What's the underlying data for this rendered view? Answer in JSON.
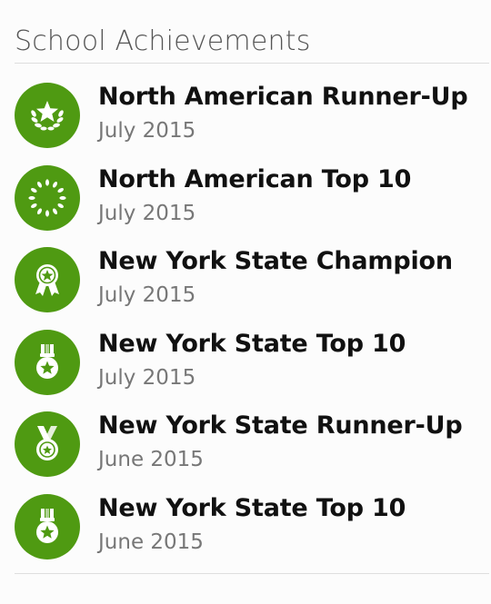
{
  "section": {
    "title": "School Achievements"
  },
  "achievements": [
    {
      "title": "North American Runner-Up",
      "date": "July 2015",
      "icon": "laurel-star-icon"
    },
    {
      "title": "North American Top 10",
      "date": "July 2015",
      "icon": "laurel-wreath-icon"
    },
    {
      "title": "New York State Champion",
      "date": "July 2015",
      "icon": "rosette-ribbon-icon"
    },
    {
      "title": "New York State Top 10",
      "date": "July 2015",
      "icon": "star-medal-icon"
    },
    {
      "title": "New York State Runner-Up",
      "date": "June 2015",
      "icon": "medal-icon"
    },
    {
      "title": "New York State Top 10",
      "date": "June 2015",
      "icon": "star-medal-icon"
    }
  ],
  "colors": {
    "badge": "#4f9a12",
    "title": "#111111",
    "date": "#777777",
    "heading": "#555555"
  }
}
